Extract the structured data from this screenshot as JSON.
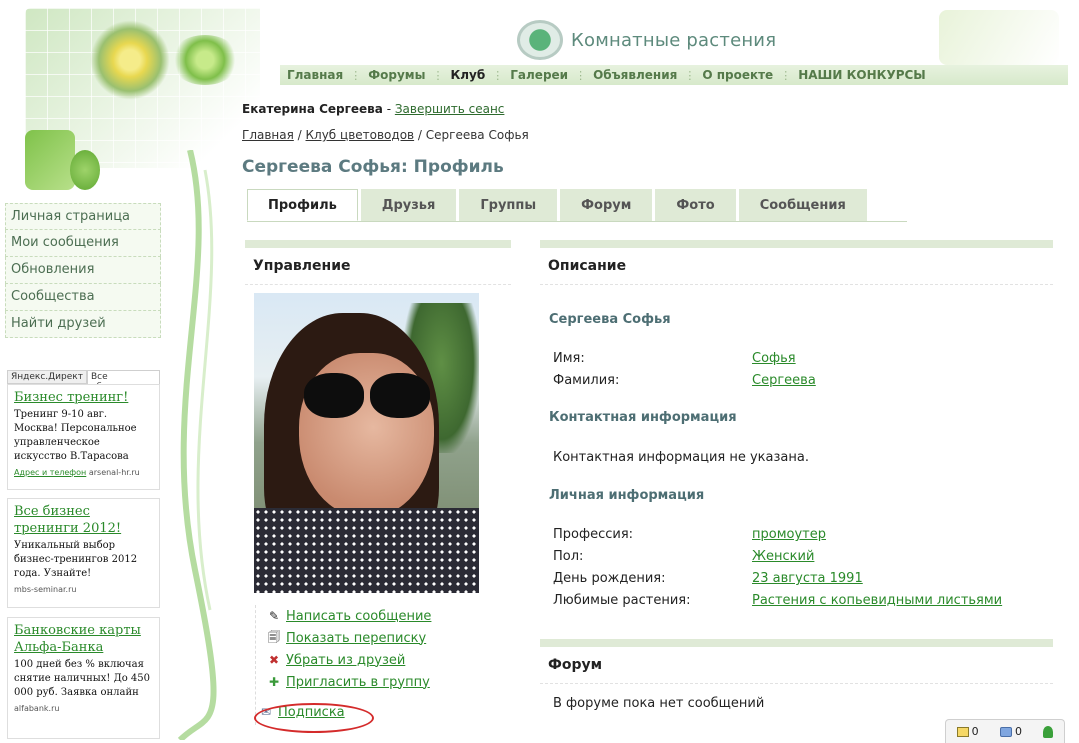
{
  "site": {
    "name": "Комнатные растения"
  },
  "topnav": [
    {
      "label": "Главная",
      "active": false
    },
    {
      "label": "Форумы",
      "active": false
    },
    {
      "label": "Клуб",
      "active": true
    },
    {
      "label": "Галереи",
      "active": false
    },
    {
      "label": "Объявления",
      "active": false
    },
    {
      "label": "О проекте",
      "active": false
    },
    {
      "label": "НАШИ КОНКУРСЫ",
      "active": false
    }
  ],
  "user": {
    "name": "Екатерина Сергеева",
    "separator": " - ",
    "logout": "Завершить сеанс"
  },
  "breadcrumb": {
    "home": "Главная",
    "club": "Клуб цветоводов",
    "current": "Сергеева Софья",
    "sep": " / "
  },
  "page_title": "Сергеева Софья: Профиль",
  "tabs": [
    {
      "label": "Профиль",
      "active": true
    },
    {
      "label": "Друзья",
      "active": false
    },
    {
      "label": "Группы",
      "active": false
    },
    {
      "label": "Форум",
      "active": false
    },
    {
      "label": "Фото",
      "active": false
    },
    {
      "label": "Сообщения",
      "active": false
    }
  ],
  "sidebar": {
    "items": [
      "Личная страница",
      "Мои сообщения",
      "Обновления",
      "Сообщества",
      "Найти друзей"
    ]
  },
  "ads": {
    "tab_direct": "Яндекс.Директ",
    "tab_all": "Все объявления",
    "items": [
      {
        "title": "Бизнес тренинг!",
        "text": "Тренинг 9-10 авг. Москва! Персональное управленческое искусство В.Тарасова",
        "link": "Адрес и телефон",
        "domain": "arsenal-hr.ru"
      },
      {
        "title": "Все бизнес тренинги 2012!",
        "text": "Уникальный выбор бизнес-тренингов 2012 года. Узнайте!",
        "link": "",
        "domain": "mbs-seminar.ru"
      },
      {
        "title": "Банковские карты Альфа-Банка",
        "text": "100 дней без % включая снятие наличных! До 450 000 руб. Заявка онлайн",
        "link": "",
        "domain": "alfabank.ru"
      }
    ]
  },
  "management": {
    "title": "Управление",
    "actions": [
      {
        "label": "Написать сообщение",
        "icon": "pencil-icon"
      },
      {
        "label": "Показать переписку",
        "icon": "document-search-icon"
      },
      {
        "label": "Убрать из друзей",
        "icon": "remove-user-icon"
      },
      {
        "label": "Пригласить в группу",
        "icon": "add-group-icon"
      }
    ],
    "subscribe": "Подписка"
  },
  "description": {
    "title": "Описание",
    "name": "Сергеева Софья",
    "first_name_label": "Имя:",
    "first_name": "Софья",
    "last_name_label": "Фамилия:",
    "last_name": "Сергеева",
    "contact_title": "Контактная информация",
    "contact_note": "Контактная информация не указана.",
    "personal_title": "Личная информация",
    "profession_label": "Профессия:",
    "profession": "промоутер",
    "gender_label": "Пол:",
    "gender": "Женский",
    "birthday_label": "День рождения:",
    "birthday": "23 августа 1991",
    "plants_label": "Любимые растения:",
    "plants": "Растения с копьевидными листьями"
  },
  "forum": {
    "title": "Форум",
    "note": "В форуме пока нет сообщений"
  },
  "status_widget": {
    "messages": "0",
    "chat": "0"
  },
  "colors": {
    "accent_green": "#2a8a2a",
    "title_blue_gray": "#5c7a80",
    "tab_bg": "#dfead6",
    "highlight_red": "#d42b2b"
  }
}
